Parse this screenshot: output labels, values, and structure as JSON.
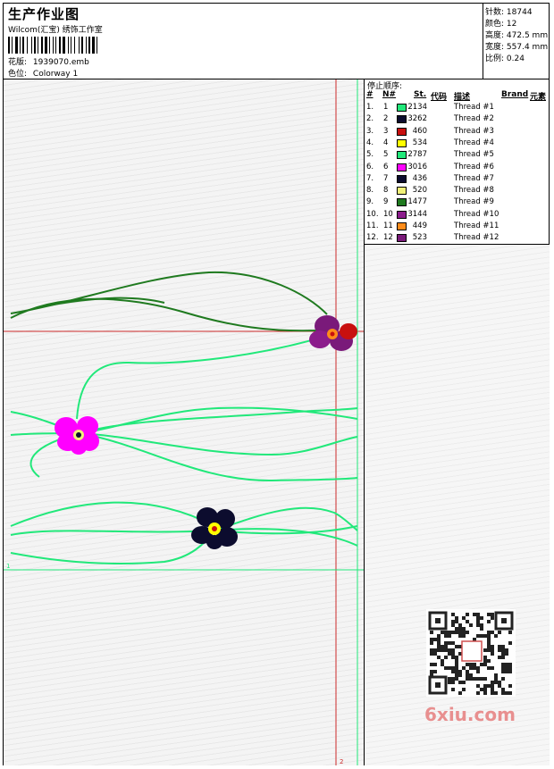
{
  "header": {
    "title": "生产作业图",
    "company": "Wilcom(汇宝) 绣饰工作室",
    "design_label": "花版:",
    "design_value": "1939070.emb",
    "color_label": "色位:",
    "color_value": "Colorway 1"
  },
  "stats": {
    "stitches_label": "针数:",
    "stitches_value": "18744",
    "colors_label": "颜色:",
    "colors_value": "12",
    "height_label": "高度:",
    "height_value": "472.5 mm",
    "width_label": "宽度:",
    "width_value": "557.4 mm",
    "scale_label": "比例:",
    "scale_value": "0.24"
  },
  "stop_sequence": {
    "title": "停止顺序:",
    "columns": [
      "#",
      "N#",
      "St.",
      "代码",
      "描述",
      "Brand",
      "元素"
    ],
    "rows": [
      {
        "index": "1.",
        "n": "1",
        "color": "#21e87a",
        "stitches": "2134",
        "desc": "Thread #1"
      },
      {
        "index": "2.",
        "n": "2",
        "color": "#0c0c2e",
        "stitches": "3262",
        "desc": "Thread #2"
      },
      {
        "index": "3.",
        "n": "3",
        "color": "#c8100f",
        "stitches": "460",
        "desc": "Thread #3"
      },
      {
        "index": "4.",
        "n": "4",
        "color": "#ffff00",
        "stitches": "534",
        "desc": "Thread #4"
      },
      {
        "index": "5.",
        "n": "5",
        "color": "#21e87a",
        "stitches": "2787",
        "desc": "Thread #5"
      },
      {
        "index": "6.",
        "n": "6",
        "color": "#ff00ff",
        "stitches": "3016",
        "desc": "Thread #6"
      },
      {
        "index": "7.",
        "n": "7",
        "color": "#0c0c2e",
        "stitches": "436",
        "desc": "Thread #7"
      },
      {
        "index": "8.",
        "n": "8",
        "color": "#f0f078",
        "stitches": "520",
        "desc": "Thread #8"
      },
      {
        "index": "9.",
        "n": "9",
        "color": "#1f7a1f",
        "stitches": "1477",
        "desc": "Thread #9"
      },
      {
        "index": "10.",
        "n": "10",
        "color": "#8b1c8b",
        "stitches": "3144",
        "desc": "Thread #10"
      },
      {
        "index": "11.",
        "n": "11",
        "color": "#ff8c1a",
        "stitches": "449",
        "desc": "Thread #11"
      },
      {
        "index": "12.",
        "n": "12",
        "color": "#7a1a7a",
        "stitches": "523",
        "desc": "Thread #12"
      }
    ]
  },
  "canvas": {
    "marker_start": "1",
    "marker_end": "2"
  },
  "watermark": {
    "text": "6xiu.com",
    "seal_text": "绣花之家"
  }
}
